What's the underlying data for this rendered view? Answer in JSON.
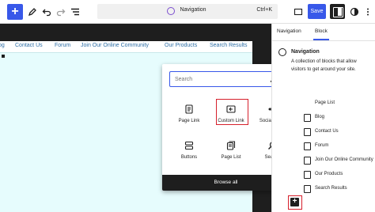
{
  "toolbar": {
    "inserter_label": "+",
    "command_label": "Navigation",
    "command_shortcut": "Ctrl+K",
    "save_label": "Save"
  },
  "navbar": {
    "items": [
      "og",
      "Contact Us",
      "Forum",
      "Join Our Online Community",
      "Our Products",
      "Search Results"
    ]
  },
  "inserter": {
    "search_placeholder": "Search",
    "blocks": [
      {
        "label": "Page Link",
        "icon": "page-icon"
      },
      {
        "label": "Custom Link",
        "icon": "custom-link-icon"
      },
      {
        "label": "Social Icons",
        "icon": "share-icon"
      },
      {
        "label": "Buttons",
        "icon": "buttons-icon"
      },
      {
        "label": "Page List",
        "icon": "page-list-icon"
      },
      {
        "label": "Search",
        "icon": "search-icon"
      }
    ],
    "browse_all": "Browse all"
  },
  "sidebar": {
    "tabs": [
      "Navigation",
      "Block"
    ],
    "active_tab": "Block",
    "block_title": "Navigation",
    "block_description": "A collection of blocks that allow visitors to get around your site.",
    "list_items": [
      "Page List",
      "Blog",
      "Contact Us",
      "Forum",
      "Join Our Online Community",
      "Our Products",
      "Search Results"
    ]
  },
  "colors": {
    "accent": "#3858e9",
    "highlight": "#d6202c",
    "dark": "#1e1e1e",
    "canvas_bg": "#e6fcfd",
    "link": "#2f6fa6"
  }
}
